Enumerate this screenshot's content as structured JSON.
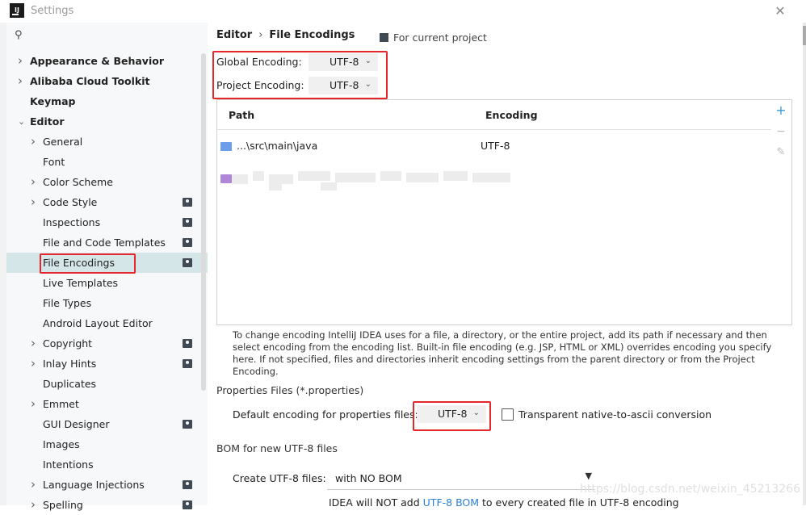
{
  "window": {
    "title": "Settings",
    "app_icon": "IJ"
  },
  "sidebar": {
    "search_icon": "search-icon",
    "items": [
      {
        "label": "Appearance & Behavior",
        "level": 0,
        "chevron": true,
        "bold": true
      },
      {
        "label": "Alibaba Cloud Toolkit",
        "level": 0,
        "chevron": true,
        "bold": true
      },
      {
        "label": "Keymap",
        "level": 0,
        "chevron": false,
        "bold": true
      },
      {
        "label": "Editor",
        "level": 0,
        "chevron": "down",
        "bold": true
      },
      {
        "label": "General",
        "level": 1,
        "chevron": true
      },
      {
        "label": "Font",
        "level": 1,
        "chevron": false
      },
      {
        "label": "Color Scheme",
        "level": 1,
        "chevron": true
      },
      {
        "label": "Code Style",
        "level": 1,
        "chevron": true,
        "project": true
      },
      {
        "label": "Inspections",
        "level": 1,
        "chevron": false,
        "project": true
      },
      {
        "label": "File and Code Templates",
        "level": 1,
        "chevron": false,
        "project": true
      },
      {
        "label": "File Encodings",
        "level": 1,
        "chevron": false,
        "project": true,
        "selected": true
      },
      {
        "label": "Live Templates",
        "level": 1,
        "chevron": false
      },
      {
        "label": "File Types",
        "level": 1,
        "chevron": false
      },
      {
        "label": "Android Layout Editor",
        "level": 1,
        "chevron": false
      },
      {
        "label": "Copyright",
        "level": 1,
        "chevron": true,
        "project": true
      },
      {
        "label": "Inlay Hints",
        "level": 1,
        "chevron": true,
        "project": true
      },
      {
        "label": "Duplicates",
        "level": 1,
        "chevron": false
      },
      {
        "label": "Emmet",
        "level": 1,
        "chevron": true
      },
      {
        "label": "GUI Designer",
        "level": 1,
        "chevron": false,
        "project": true
      },
      {
        "label": "Images",
        "level": 1,
        "chevron": false
      },
      {
        "label": "Intentions",
        "level": 1,
        "chevron": false
      },
      {
        "label": "Language Injections",
        "level": 1,
        "chevron": true,
        "project": true
      },
      {
        "label": "Spelling",
        "level": 1,
        "chevron": true,
        "project": true
      }
    ]
  },
  "main": {
    "breadcrumb": {
      "parent": "Editor",
      "separator": "›",
      "current": "File Encodings"
    },
    "for_project": "For current project",
    "global_encoding": {
      "label": "Global Encoding:",
      "value": "UTF-8"
    },
    "project_encoding": {
      "label": "Project Encoding:",
      "value": "UTF-8"
    },
    "table": {
      "headers": {
        "path": "Path",
        "encoding": "Encoding"
      },
      "rows": [
        {
          "path": "...\\src\\main\\java",
          "encoding": "UTF-8"
        }
      ],
      "buttons": {
        "add": "+",
        "remove": "−",
        "edit": "✎"
      }
    },
    "help_text": "To change encoding IntelliJ IDEA uses for a file, a directory, or the entire project, add its path if necessary and then select encoding from the encoding list. Built-in file encoding (e.g. JSP, HTML or XML) overrides encoding you specify here. If not specified, files and directories inherit encoding settings from the parent directory or from the Project Encoding.",
    "properties": {
      "title": "Properties Files (*.properties)",
      "default_label": "Default encoding for properties files:",
      "default_value": "UTF-8",
      "transparent_label": "Transparent native-to-ascii conversion",
      "transparent_checked": false
    },
    "bom": {
      "title": "BOM for new UTF-8 files",
      "create_label": "Create UTF-8 files:",
      "create_value": "with NO BOM",
      "note_prefix": "IDEA will NOT add ",
      "note_link": "UTF-8 BOM",
      "note_suffix": " to every created file in UTF-8 encoding"
    }
  },
  "watermark": "https://blog.csdn.net/weixin_45213266",
  "colors": {
    "highlight_box": "#e5262b",
    "selected_row": "#d5e6e8",
    "link": "#2b7fd8"
  }
}
